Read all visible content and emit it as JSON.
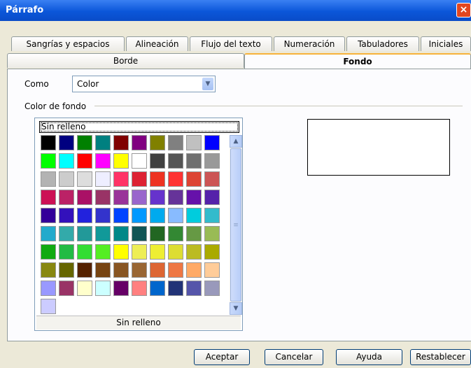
{
  "window": {
    "title": "Párrafo",
    "close_label": "×"
  },
  "tabs_row1": [
    "Sangrías y espacios",
    "Alineación",
    "Flujo del texto",
    "Numeración",
    "Tabuladores",
    "Iniciales"
  ],
  "tabs_row2": [
    {
      "label": "Borde",
      "active": false
    },
    {
      "label": "Fondo",
      "active": true
    }
  ],
  "como": {
    "label": "Como",
    "value": "Color"
  },
  "section": {
    "label": "Color de fondo"
  },
  "colorset": {
    "no_fill": "Sin relleno",
    "caption": "Sin relleno"
  },
  "colors": [
    "#000000",
    "#000080",
    "#008000",
    "#008080",
    "#800000",
    "#800080",
    "#808000",
    "#808080",
    "#c0c0c0",
    "#0000ff",
    "#00ff00",
    "#00ffff",
    "#ff0000",
    "#ff00ff",
    "#ffff00",
    "#ffffff",
    "#404040",
    "#555555",
    "#707070",
    "#999999",
    "#b3b3b3",
    "#cccccc",
    "#dddddd",
    "#eeeeff",
    "#ff3366",
    "#dd2233",
    "#ee3322",
    "#ff3333",
    "#dd4433",
    "#cc5555",
    "#cc1155",
    "#bb2266",
    "#aa1166",
    "#993366",
    "#993399",
    "#9966cc",
    "#6633cc",
    "#663399",
    "#6611aa",
    "#5522aa",
    "#330099",
    "#3311bb",
    "#2222dd",
    "#3333cc",
    "#0044ff",
    "#0099ff",
    "#00aaee",
    "#88bbff",
    "#00ccdd",
    "#33bbcc",
    "#22aacc",
    "#33aaaa",
    "#229999",
    "#119999",
    "#008888",
    "#115555",
    "#226622",
    "#338833",
    "#669944",
    "#99bb55",
    "#11aa11",
    "#22bb44",
    "#33dd33",
    "#55ee22",
    "#ffff00",
    "#eeee55",
    "#eeee33",
    "#dddd33",
    "#bbbb22",
    "#aaaa00",
    "#888811",
    "#666600",
    "#552200",
    "#774411",
    "#885522",
    "#996633",
    "#dd6633",
    "#ee7744",
    "#ffaa66",
    "#ffcc99",
    "#9999ff",
    "#993366",
    "#ffffcc",
    "#ccffff",
    "#660066",
    "#ff8080",
    "#0066cc",
    "#223377",
    "#5555aa",
    "#9999bb",
    "#ccccff"
  ],
  "buttons": {
    "ok": "Aceptar",
    "cancel": "Cancelar",
    "help": "Ayuda",
    "reset": "Restablecer"
  }
}
